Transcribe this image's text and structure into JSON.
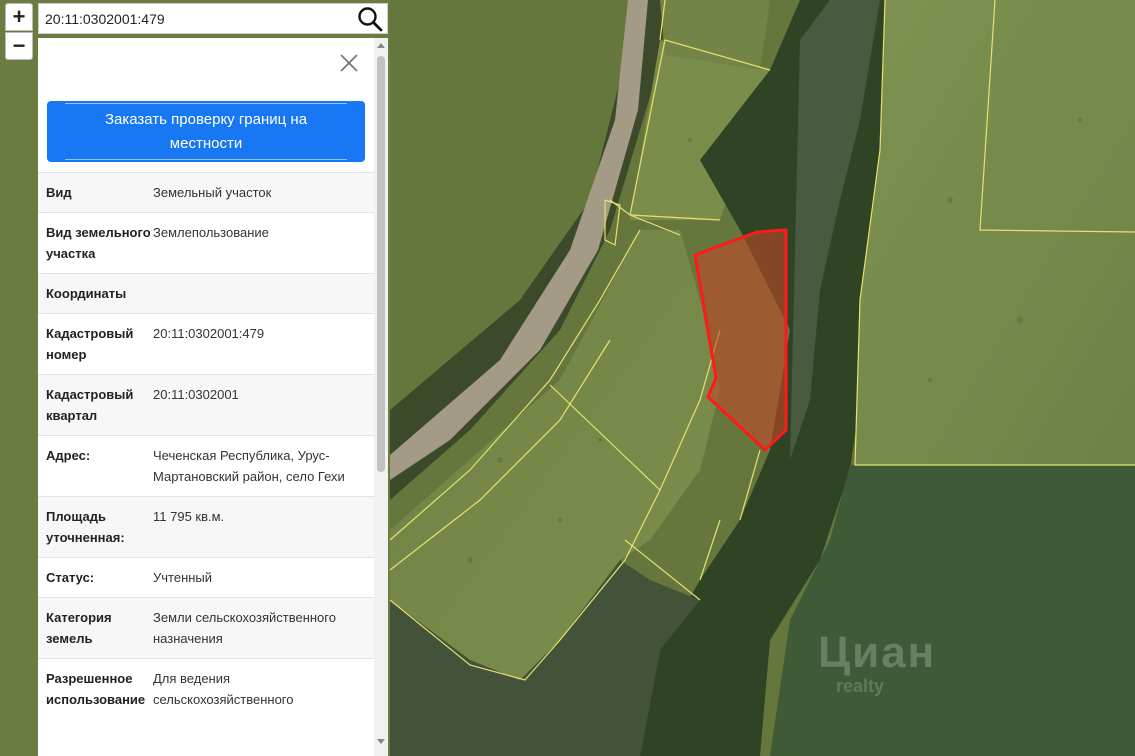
{
  "search": {
    "value": "20:11:0302001:479"
  },
  "zoom": {
    "in_label": "+",
    "out_label": "−"
  },
  "panel": {
    "order_button": "Заказать проверку границ на местности",
    "rows": [
      {
        "key": "Вид",
        "value": "Земельный участок"
      },
      {
        "key": "Вид земельного участка",
        "value": "Землепользование"
      },
      {
        "key": "Координаты",
        "value": ""
      },
      {
        "key": "Кадастровый номер",
        "value": "20:11:0302001:479"
      },
      {
        "key": "Кадастровый квартал",
        "value": "20:11:0302001"
      },
      {
        "key": "Адрес:",
        "value": "Чеченская Республика, Урус-Мартановский район, село Гехи"
      },
      {
        "key": "Площадь уточненная:",
        "value": "11 795 кв.м."
      },
      {
        "key": "Статус:",
        "value": "Учтенный"
      },
      {
        "key": "Категория земель",
        "value": "Земли сельскохозяйственного назначения"
      },
      {
        "key": "Разрешенное использование",
        "value": "Для ведения сельскохозяйственного"
      }
    ]
  },
  "map": {
    "watermark": "Циан",
    "watermark_sub": "realty",
    "colors": {
      "parcel_outline": "#ff1a1a",
      "parcel_fill": "#c04a28",
      "boundary": "#e8e070"
    }
  }
}
